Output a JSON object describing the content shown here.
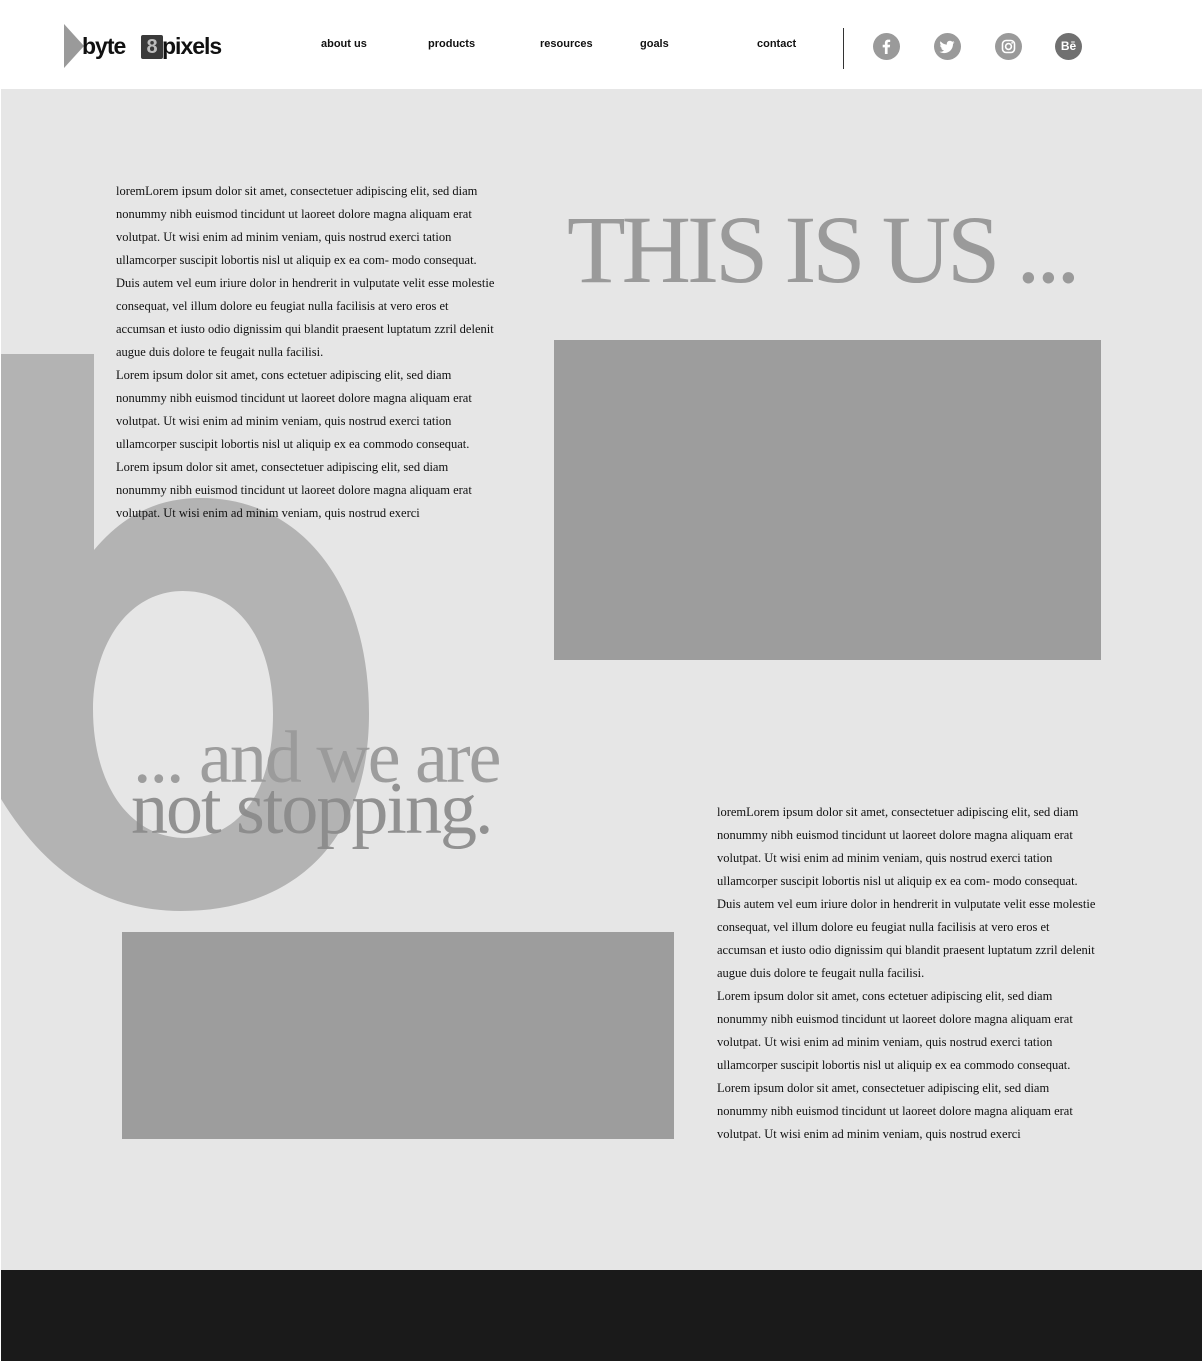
{
  "brand": {
    "name_left": "byte",
    "name_mark": "8",
    "name_right": "pixels"
  },
  "nav": {
    "items": [
      {
        "label": "about us"
      },
      {
        "label": "products"
      },
      {
        "label": "resources"
      },
      {
        "label": "goals"
      },
      {
        "label": "contact"
      }
    ]
  },
  "social": [
    {
      "icon": "facebook-icon"
    },
    {
      "icon": "twitter-icon"
    },
    {
      "icon": "instagram-icon"
    },
    {
      "icon": "behance-icon",
      "label": "Bē"
    }
  ],
  "hero": {
    "title": "THIS IS US ...",
    "decor_letter": "b"
  },
  "intro": {
    "paragraphs": [
      "loremLorem ipsum dolor sit amet, consectetuer adipiscing elit, sed diam nonummy nibh euismod tincidunt ut laoreet dolore magna aliquam erat volutpat. Ut wisi enim ad minim veniam, quis nostrud exerci tation ullamcorper suscipit lobortis nisl ut aliquip ex ea com- modo consequat. Duis autem vel eum iriure dolor in hendrerit in vulputate velit esse molestie consequat, vel illum dolore eu feugiat nulla facilisis at vero eros et accumsan et iusto odio dignissim qui blandit praesent luptatum zzril delenit augue duis dolore te feugait nulla facilisi.",
      "Lorem ipsum dolor sit amet, cons ectetuer adipiscing elit, sed diam nonummy nibh euismod tincidunt ut laoreet dolore magna aliquam erat volutpat. Ut wisi enim ad minim veniam, quis nostrud exerci tation ullamcorper suscipit lobortis nisl ut aliquip ex ea commodo consequat.",
      "Lorem ipsum dolor sit amet, consectetuer adipiscing elit, sed diam nonummy nibh euismod tincidunt ut laoreet dolore magna aliquam erat volutpat. Ut wisi enim ad minim veniam, quis nostrud exerci"
    ]
  },
  "tagline": {
    "line1": "... and we are",
    "line2": "not stopping."
  },
  "outro": {
    "paragraphs": [
      "loremLorem ipsum dolor sit amet, consectetuer adipiscing elit, sed diam nonummy nibh euismod tincidunt ut laoreet dolore magna aliquam erat volutpat. Ut wisi enim ad minim veniam, quis nostrud exerci tation ullamcorper suscipit lobortis nisl ut aliquip ex ea com- modo consequat. Duis autem vel eum iriure dolor in hendrerit in vulputate velit esse molestie consequat, vel illum dolore eu feugiat nulla facilisis at vero eros et accumsan et iusto odio dignissim qui blandit praesent luptatum zzril delenit augue duis dolore te feugait nulla facilisi.",
      "Lorem ipsum dolor sit amet, cons ectetuer adipiscing elit, sed diam nonummy nibh euismod tincidunt ut laoreet dolore magna aliquam erat volutpat. Ut wisi enim ad minim veniam, quis nostrud exerci tation ullamcorper suscipit lobortis nisl ut aliquip ex ea commodo consequat.",
      "Lorem ipsum dolor sit amet, consectetuer adipiscing elit, sed diam nonummy nibh euismod tincidunt ut laoreet dolore magna aliquam erat volutpat. Ut wisi enim ad minim veniam, quis nostrud exerci"
    ]
  },
  "colors": {
    "header_bg": "#ffffff",
    "main_bg": "#e6e6e6",
    "placeholder": "#9d9d9d",
    "display_text": "#9a9a9a",
    "footer_bg": "#1a1a1a"
  }
}
